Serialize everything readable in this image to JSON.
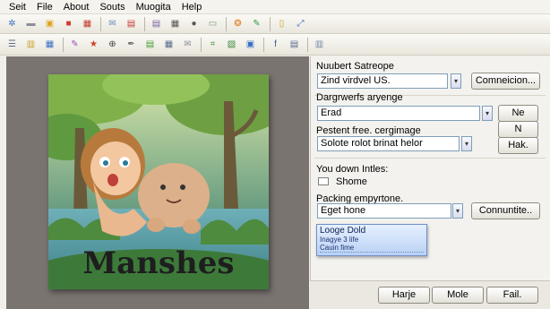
{
  "menu": [
    "Seit",
    "File",
    "About",
    "Souts",
    "Muogita",
    "Help"
  ],
  "toolbar_row1": [
    {
      "icon": "gear-blue-icon",
      "color": "#3a6fc4",
      "glyph": "✲"
    },
    {
      "icon": "drive-icon",
      "color": "#8a8f99",
      "glyph": "▬"
    },
    {
      "icon": "folder-lock-icon",
      "color": "#e0a526",
      "glyph": "▣"
    },
    {
      "icon": "red-box-icon",
      "color": "#d33a2c",
      "glyph": "■"
    },
    {
      "icon": "calendar-icon",
      "color": "#c0392b",
      "glyph": "▦"
    },
    {
      "icon": "mail-icon",
      "color": "#6b8cc6",
      "glyph": "✉"
    },
    {
      "icon": "save-icon",
      "color": "#c83a3a",
      "glyph": "▤"
    },
    {
      "icon": "document-icon",
      "color": "#7a5fa8",
      "glyph": "▤"
    },
    {
      "icon": "grid-icon",
      "color": "#555555",
      "glyph": "▦"
    },
    {
      "icon": "user-icon",
      "color": "#555555",
      "glyph": "●"
    },
    {
      "icon": "window-icon",
      "color": "#7a9a6a",
      "glyph": "▭"
    },
    {
      "icon": "paint-icon",
      "color": "#e07b1f",
      "glyph": "❂"
    },
    {
      "icon": "image-edit-icon",
      "color": "#2f9a4a",
      "glyph": "✎"
    },
    {
      "icon": "page-icon",
      "color": "#c9a227",
      "glyph": "▯"
    },
    {
      "icon": "transform-icon",
      "color": "#3a6fc4",
      "glyph": "⤢"
    }
  ],
  "toolbar_row2": [
    {
      "icon": "list-icon",
      "color": "#5a6a8a",
      "glyph": "☰"
    },
    {
      "icon": "clipboard-icon",
      "color": "#c9a227",
      "glyph": "▥"
    },
    {
      "icon": "table-icon",
      "color": "#3a6fc4",
      "glyph": "▦"
    },
    {
      "icon": "brush-icon",
      "color": "#a04ac0",
      "glyph": "✎"
    },
    {
      "icon": "star-icon",
      "color": "#d04020",
      "glyph": "★"
    },
    {
      "icon": "zoom-icon",
      "color": "#444444",
      "glyph": "⊕"
    },
    {
      "icon": "pen-icon",
      "color": "#6a6a6a",
      "glyph": "✒"
    },
    {
      "icon": "page-green-icon",
      "color": "#4a9a3a",
      "glyph": "▤"
    },
    {
      "icon": "grid-small-icon",
      "color": "#5a6a8a",
      "glyph": "▦"
    },
    {
      "icon": "envelope-icon",
      "color": "#8a8f99",
      "glyph": "✉"
    },
    {
      "icon": "crop-icon",
      "color": "#4a9a3a",
      "glyph": "⌗"
    },
    {
      "icon": "layers-icon",
      "color": "#3a8a3a",
      "glyph": "▧"
    },
    {
      "icon": "frame-icon",
      "color": "#3a6fc4",
      "glyph": "▣"
    },
    {
      "icon": "facebook-icon",
      "color": "#3b5998",
      "glyph": "f"
    },
    {
      "icon": "view-icon",
      "color": "#5a6a8a",
      "glyph": "▤"
    },
    {
      "icon": "panel-icon",
      "color": "#7a8aa8",
      "glyph": "▥"
    }
  ],
  "artwork": {
    "title_text": "Manshes"
  },
  "panel": {
    "section1": {
      "label": "Nuubert Satreope",
      "value": "Zind virdvel US.",
      "button": "Comneicion..."
    },
    "section2": {
      "label": "Dargrwerfs aryenge",
      "value": "Erad",
      "button": "Ne",
      "extra_button": "N"
    },
    "section3": {
      "label": "Pestent free. cergimage",
      "value": "Solote rolot brinat helor",
      "button": "Hak."
    },
    "section4": {
      "label": "You down Intles:",
      "option": "Shome"
    },
    "section5": {
      "label": "Packing empyrtone.",
      "value": "Eget hone",
      "button": "Connuntite.."
    },
    "dropdown": {
      "option1": "Looge Dold",
      "option2": "Inagye 3 life",
      "option3": "Cauin fime"
    }
  },
  "footer": {
    "btn1": "Harje",
    "btn2": "Mole",
    "btn3": "Fail."
  }
}
